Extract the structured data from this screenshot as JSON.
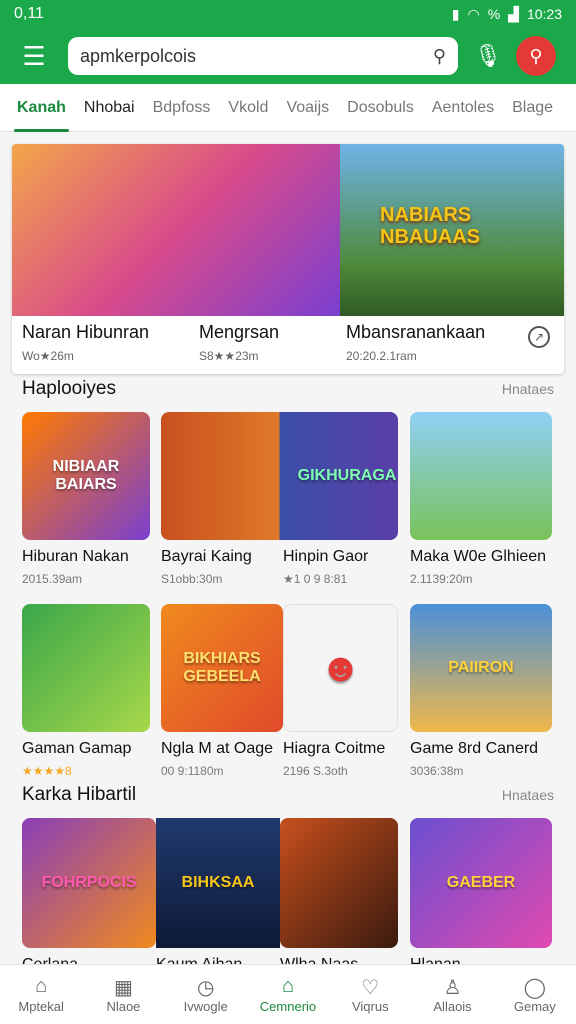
{
  "status": {
    "time": "0,11",
    "right_time": "10:23",
    "battery": "%"
  },
  "search": {
    "value": "apmkerpolcois"
  },
  "tabs": [
    {
      "label": "Kanah",
      "active": true
    },
    {
      "label": "Nhobai"
    },
    {
      "label": "Bdpfoss"
    },
    {
      "label": "Vkold"
    },
    {
      "label": "Voaijs"
    },
    {
      "label": "Dosobuls"
    },
    {
      "label": "Aentoles"
    },
    {
      "label": "Blage"
    }
  ],
  "hero": {
    "items": [
      {
        "title": "Naran Hibunran",
        "stars": "★★",
        "meta": "Wo★26m"
      },
      {
        "title": "Mengrsan",
        "stars": "★★",
        "meta": "S8★★23m"
      },
      {
        "title": "Mbansranankaan",
        "stars": "",
        "meta": "20:20.2.1ram"
      }
    ],
    "banner_text": "NABIARS NBAUAAS"
  },
  "sections": [
    {
      "title": "Haplooiyes",
      "more": "Hnataes",
      "cards": [
        {
          "name": "Hiburan Nakan",
          "meta": "2015.39am",
          "art": "NIBIAAR BAIARS",
          "color": "#7a3fd0"
        },
        {
          "name": "Bayrai Kaing",
          "meta": "S1obb:30m",
          "art": "",
          "color": "#b5542a"
        },
        {
          "name": "Hinpin Gaor",
          "meta": "★1 0 9 8:81",
          "art": "GIKHURAGA",
          "color": "#3a4fa8"
        },
        {
          "name": "Maka W0e Glhieen",
          "meta": "2.1139:20m",
          "art": "",
          "color": "#5aa7e0"
        }
      ]
    },
    {
      "title": "Karka Hibartil",
      "more": "Hnataes",
      "cards": [
        {
          "name": "Gaman Gamap",
          "meta": "★★★★8",
          "art": "",
          "color": "#3aa74a"
        },
        {
          "name": "Ngla M at Oage",
          "meta": "00 9:1180m",
          "art": "BIKHIARS GEBEELA",
          "color": "#f08a1e"
        },
        {
          "name": "Hiagra Coitme",
          "meta": "2196 S.3oth",
          "art": "",
          "color": "#f4f4f4"
        },
        {
          "name": "Game 8rd Canerd",
          "meta": "3036:38m",
          "art": "PAIIRON",
          "color": "#4a90d9"
        }
      ]
    },
    {
      "title": "",
      "more": "",
      "cards": [
        {
          "name": "Cerlana",
          "meta": "",
          "art": "FOHRPOCIS",
          "color": "#8a3fb8"
        },
        {
          "name": "Kaum Aihan",
          "meta": "",
          "art": "BIHKSAA",
          "color": "#1f3a6e"
        },
        {
          "name": "Wlha Naas",
          "meta": "",
          "art": "",
          "color": "#c8501e"
        },
        {
          "name": "Hlanan",
          "meta": "",
          "art": "GAEBER",
          "color": "#6a4fd0"
        }
      ]
    }
  ],
  "bottom_nav": [
    {
      "label": "Mptekal",
      "icon": "home-icon"
    },
    {
      "label": "Nlaoe",
      "icon": "grid-icon"
    },
    {
      "label": "Ivwogle",
      "icon": "compass-icon"
    },
    {
      "label": "Cemnerio",
      "icon": "store-icon",
      "active": true
    },
    {
      "label": "Viqrus",
      "icon": "heart-icon"
    },
    {
      "label": "Allaois",
      "icon": "person-icon"
    },
    {
      "label": "Gemay",
      "icon": "account-icon"
    }
  ]
}
